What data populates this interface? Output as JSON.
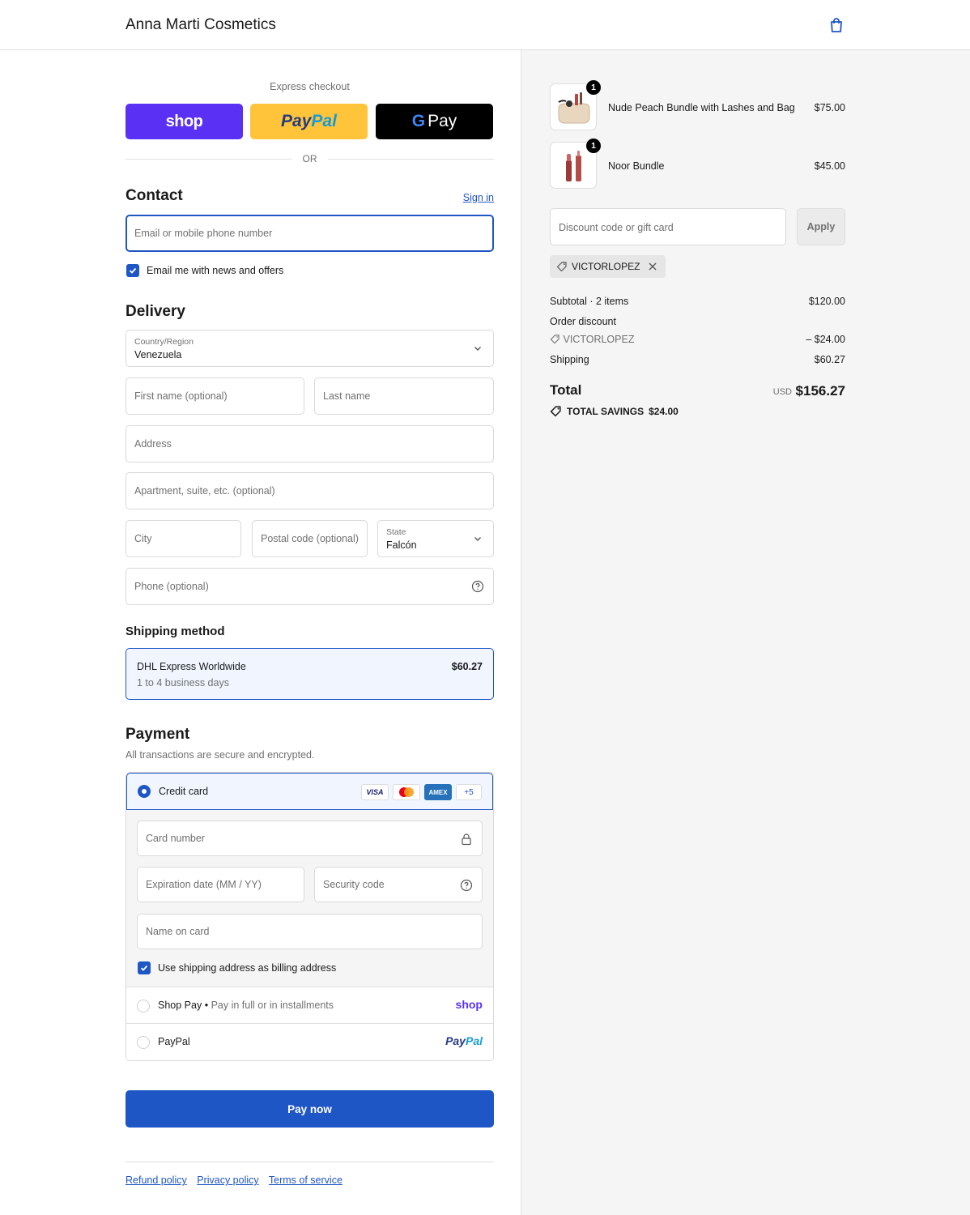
{
  "header": {
    "brand": "Anna Marti Cosmetics",
    "cart_icon": "shopping-bag-icon"
  },
  "express": {
    "title": "Express checkout",
    "shop_label": "shop",
    "paypal_part1": "Pay",
    "paypal_part2": "Pal",
    "gpay_g": "G",
    "gpay_label": "Pay",
    "or": "OR"
  },
  "contact": {
    "title": "Contact",
    "sign_in": "Sign in",
    "email_placeholder": "Email or mobile phone number",
    "newsletter_label": "Email me with news and offers",
    "newsletter_checked": true
  },
  "delivery": {
    "title": "Delivery",
    "country_label": "Country/Region",
    "country_value": "Venezuela",
    "first_name_ph": "First name (optional)",
    "last_name_ph": "Last name",
    "address_ph": "Address",
    "apartment_ph": "Apartment, suite, etc. (optional)",
    "city_ph": "City",
    "postal_ph": "Postal code (optional)",
    "state_label": "State",
    "state_value": "Falcón",
    "phone_ph": "Phone (optional)"
  },
  "shipping": {
    "title": "Shipping method",
    "name": "DHL Express Worldwide",
    "days": "1 to 4 business days",
    "price": "$60.27"
  },
  "payment": {
    "title": "Payment",
    "subtitle": "All transactions are secure and encrypted.",
    "credit_card_label": "Credit card",
    "badges": {
      "visa": "VISA",
      "amex": "AMEX",
      "more": "+5"
    },
    "card_number_ph": "Card number",
    "expiry_ph": "Expiration date (MM / YY)",
    "security_ph": "Security code",
    "name_on_card_ph": "Name on card",
    "billing_same_label": "Use shipping address as billing address",
    "billing_same_checked": true,
    "shop_pay_label": "Shop Pay",
    "shop_pay_sep": "•",
    "shop_pay_sub": "Pay in full or in installments",
    "shop_pay_logo": "shop",
    "paypal_label": "PayPal",
    "paypal_logo_1": "Pay",
    "paypal_logo_2": "Pal",
    "pay_now": "Pay now"
  },
  "footer": {
    "refund": "Refund policy",
    "privacy": "Privacy policy",
    "terms": "Terms of service"
  },
  "summary": {
    "items": [
      {
        "name": "Nude Peach Bundle with Lashes and Bag",
        "price": "$75.00",
        "qty": "1"
      },
      {
        "name": "Noor Bundle",
        "price": "$45.00",
        "qty": "1"
      }
    ],
    "discount_ph": "Discount code or gift card",
    "apply": "Apply",
    "code": "VICTORLOPEZ",
    "subtotal_label": "Subtotal · 2 items",
    "subtotal": "$120.00",
    "order_discount_label": "Order discount",
    "discount_code": "VICTORLOPEZ",
    "discount_amount": "– $24.00",
    "shipping_label": "Shipping",
    "shipping": "$60.27",
    "total_label": "Total",
    "currency": "USD",
    "total": "$156.27",
    "savings_label": "TOTAL SAVINGS",
    "savings": "$24.00"
  },
  "colors": {
    "accent": "#1f56c5",
    "shop": "#5a31f4",
    "paypal": "#ffc439"
  }
}
